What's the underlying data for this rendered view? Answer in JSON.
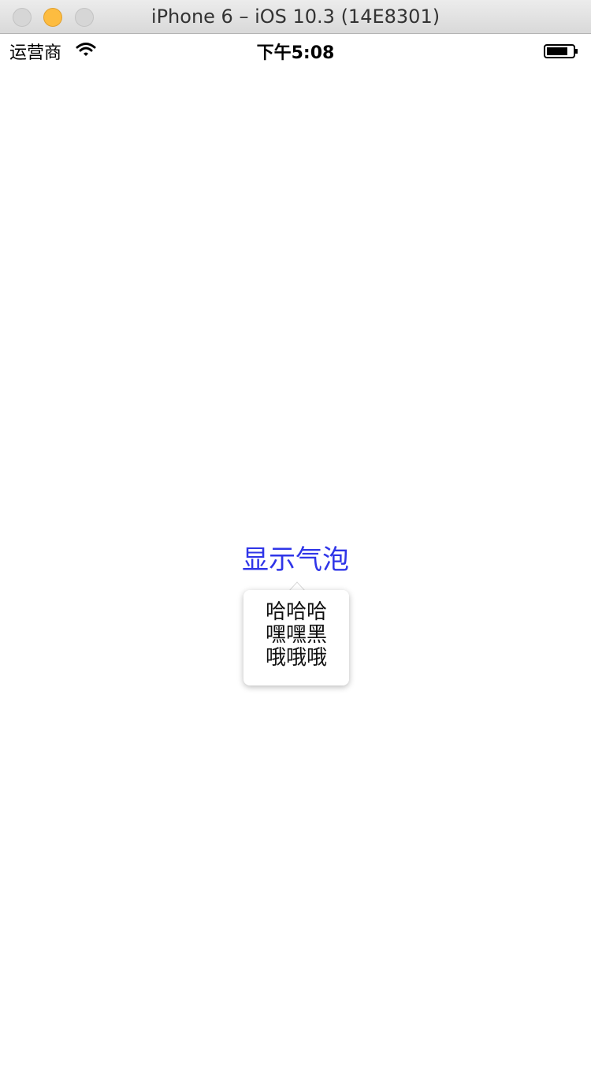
{
  "window": {
    "title": "iPhone 6 – iOS 10.3 (14E8301)",
    "traffic_lights": [
      "close",
      "minimize",
      "zoom"
    ]
  },
  "status_bar": {
    "carrier": "运营商",
    "time": "下午5:08",
    "wifi_icon": "wifi-icon",
    "battery_icon": "battery-icon"
  },
  "main": {
    "show_bubble_label": "显示气泡",
    "accent_color": "#2f35e8",
    "bubble": {
      "lines": [
        "哈哈哈",
        "嘿嘿黑",
        "哦哦哦"
      ]
    }
  }
}
